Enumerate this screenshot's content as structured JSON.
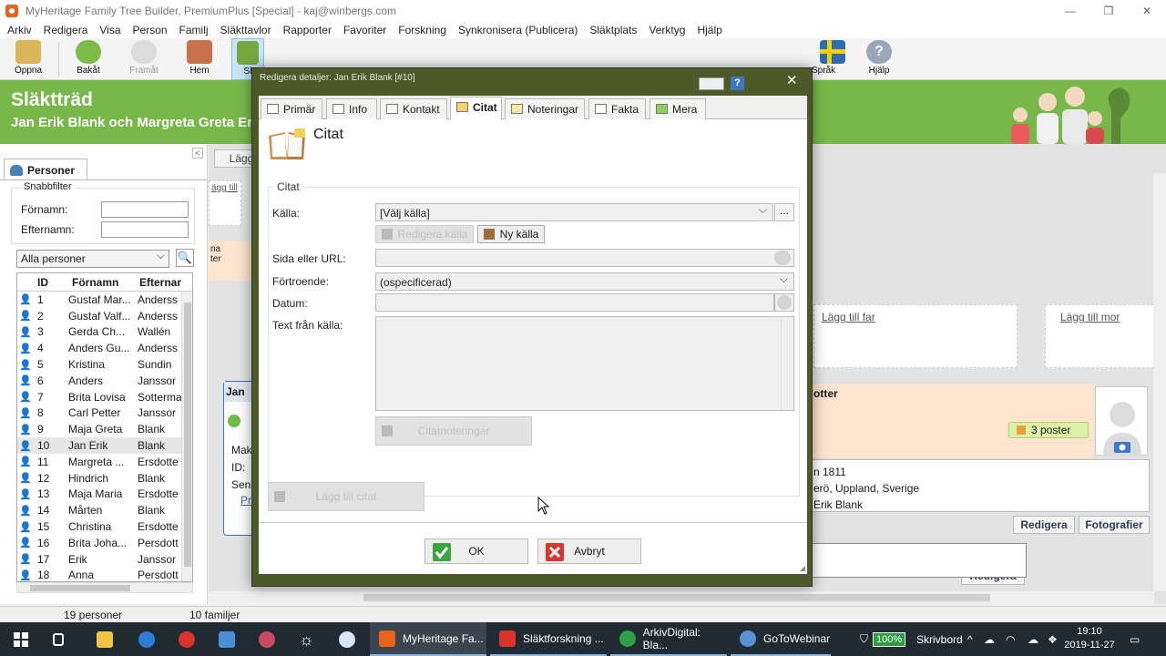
{
  "window": {
    "title": "MyHeritage Family Tree Builder, PremiumPlus [Special] - kaj@winbergs.com",
    "controls": [
      "—",
      "❐",
      "✕"
    ]
  },
  "menu": [
    "Arkiv",
    "Redigera",
    "Visa",
    "Person",
    "Familj",
    "Släkttavlor",
    "Rapporter",
    "Favoriter",
    "Forskning",
    "Synkronisera (Publicera)",
    "Släktplats",
    "Verktyg",
    "Hjälp"
  ],
  "toolbar": {
    "open": "Öppna",
    "back": "Bakåt",
    "forward": "Framåt",
    "home": "Hem",
    "tree_partial": "Sl",
    "language": "Språk",
    "help": "Hjälp"
  },
  "banner": {
    "title": "Släktträd",
    "subtitle": "Jan Erik Blank och Margreta Greta Ers"
  },
  "left_panel": {
    "tab_label": "Personer",
    "quick_filter": "Snabbfilter",
    "first_name_label": "Förnamn:",
    "last_name_label": "Efternamn:",
    "filter_value": "Alla personer",
    "columns": [
      "ID",
      "Förnamn",
      "Efternar"
    ],
    "rows": [
      {
        "id": "1",
        "first": "Gustaf Mar...",
        "last": "Anderss"
      },
      {
        "id": "2",
        "first": "Gustaf Valf...",
        "last": "Anderss"
      },
      {
        "id": "3",
        "first": "Gerda Ch...",
        "last": "Wallén"
      },
      {
        "id": "4",
        "first": "Anders Gu...",
        "last": "Anderss"
      },
      {
        "id": "5",
        "first": "Kristina",
        "last": "Sundin"
      },
      {
        "id": "6",
        "first": "Anders",
        "last": "Janssor"
      },
      {
        "id": "7",
        "first": "Brita Lovisa",
        "last": "Sotterma"
      },
      {
        "id": "8",
        "first": "Carl Petter",
        "last": "Janssor"
      },
      {
        "id": "9",
        "first": "Maja Greta",
        "last": "Blank"
      },
      {
        "id": "10",
        "first": "Jan Erik",
        "last": "Blank"
      },
      {
        "id": "11",
        "first": "Margreta ...",
        "last": "Ersdotte"
      },
      {
        "id": "12",
        "first": "Hindrich",
        "last": "Blank"
      },
      {
        "id": "13",
        "first": "Maja Maria",
        "last": "Ersdotte"
      },
      {
        "id": "14",
        "first": "Mårten",
        "last": "Blank"
      },
      {
        "id": "15",
        "first": "Christina",
        "last": "Ersdotte"
      },
      {
        "id": "16",
        "first": "Brita Joha...",
        "last": "Persdott"
      },
      {
        "id": "17",
        "first": "Erik",
        "last": "Janssor"
      },
      {
        "id": "18",
        "first": "Anna",
        "last": "Persdott"
      }
    ]
  },
  "tree": {
    "add_btn_partial": "Lägg",
    "add_link_partial": "ägg till",
    "na": "na",
    "ter": "ter",
    "add_father": "Lägg till far",
    "add_mother": "Lägg till mor",
    "person_name_partial": "Jan",
    "main_person_partial": "otter",
    "posts_badge": "3 poster",
    "info_line1": "n 1811",
    "info_line2": "erö, Uppland, Sverige",
    "info_line3": "Erik Blank",
    "left_labels": [
      "Mak",
      "ID:",
      "Sen"
    ],
    "pri_partial": "Pr",
    "edit_btn": "Redigera",
    "photos_btn": "Fotografier",
    "edit_btn2": "Redigera"
  },
  "status": {
    "persons": "19 personer",
    "families": "10 familjer"
  },
  "dialog": {
    "title": "Redigera detaljer: Jan Erik Blank [#10]",
    "help": "?",
    "close": "✕",
    "tabs": [
      "Primär",
      "Info",
      "Kontakt",
      "Citat",
      "Noteringar",
      "Fakta",
      "Mera"
    ],
    "active_tab": "Citat",
    "heading": "Citat",
    "group_label": "Citat",
    "source_label": "Källa:",
    "source_value": "[Välj källa]",
    "more_btn": "...",
    "edit_source_btn": "Redigera källa",
    "new_source_btn": "Ny källa",
    "page_label": "Sida eller URL:",
    "confidence_label": "Förtroende:",
    "confidence_value": "(ospecificerad)",
    "date_label": "Datum:",
    "text_label": "Text från källa:",
    "citation_notes_btn": "Citatnoteringar",
    "add_citation_btn": "Lägg till citat",
    "ok": "OK",
    "cancel": "Avbryt"
  },
  "taskbar": {
    "apps": [
      {
        "label": "MyHeritage Fa...",
        "color": "#e8641c"
      },
      {
        "label": "Släktforskning ...",
        "color": "#d9342b"
      },
      {
        "label": "ArkivDigital: Bla...",
        "color": "#2f9e44"
      },
      {
        "label": "GoToWebinar",
        "color": "#5b8fd6"
      }
    ],
    "battery": "100%",
    "desktop": "Skrivbord",
    "time": "19:10",
    "date": "2019-11-27"
  }
}
